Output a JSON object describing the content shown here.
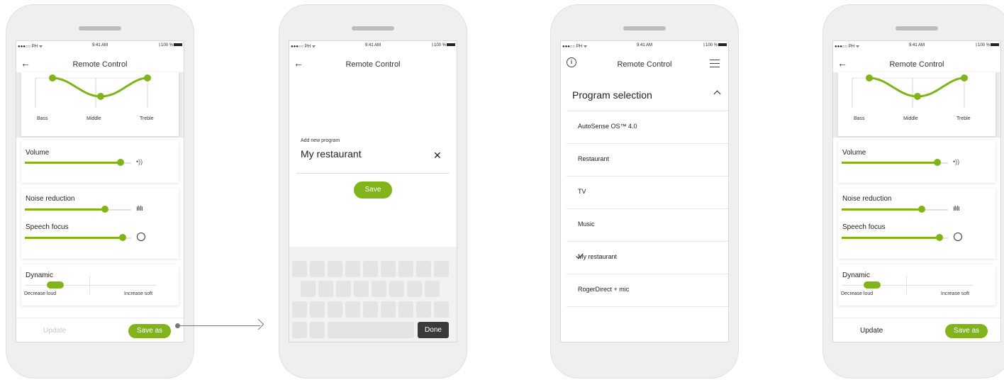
{
  "status": {
    "carrier": "●●●○○ PH",
    "time": "9:41 AM",
    "battery": "100 %"
  },
  "screen1": {
    "title": "Remote Control",
    "eq": {
      "labels": [
        "Bass",
        "Middle",
        "Treble"
      ]
    },
    "volume": {
      "label": "Volume",
      "level": 0.9
    },
    "noise": {
      "label": "Noise reduction",
      "level": 0.72
    },
    "speech": {
      "label": "Speech focus",
      "level": 0.92
    },
    "dynamic": {
      "label": "Dynamic",
      "left": "Decrease loud",
      "right": "Increase soft"
    },
    "update_label": "Update",
    "save_as_label": "Save as"
  },
  "screen2": {
    "title": "Remote Control",
    "field_caption": "Add new program",
    "field_value": "My restaurant",
    "save_label": "Save",
    "done_label": "Done"
  },
  "screen3": {
    "title": "Remote Control",
    "heading": "Program selection",
    "programs": [
      "AutoSense OS™ 4.0",
      "Restaurant",
      "TV",
      "Music",
      "My restaurant",
      "RogerDirect + mic"
    ],
    "selected_index": 4
  },
  "screen4": {
    "title": "Remote Control",
    "eq": {
      "labels": [
        "Bass",
        "Middle",
        "Treble"
      ]
    },
    "volume": {
      "label": "Volume",
      "level": 0.9
    },
    "noise": {
      "label": "Noise reduction",
      "level": 0.72
    },
    "speech": {
      "label": "Speech focus",
      "level": 0.92
    },
    "dynamic": {
      "label": "Dynamic",
      "left": "Decrease loud",
      "right": "Increase soft"
    },
    "update_label": "Update",
    "save_as_label": "Save as"
  },
  "colors": {
    "accent": "#80b41a",
    "done_key": "#3a3a3a"
  },
  "icons": [
    "back-arrow-icon",
    "info-icon",
    "menu-icon",
    "close-icon",
    "chevron-up-icon",
    "checkmark-icon",
    "volume-icon",
    "noise-icon",
    "speech-focus-icon",
    "bluetooth-icon",
    "wifi-icon"
  ]
}
